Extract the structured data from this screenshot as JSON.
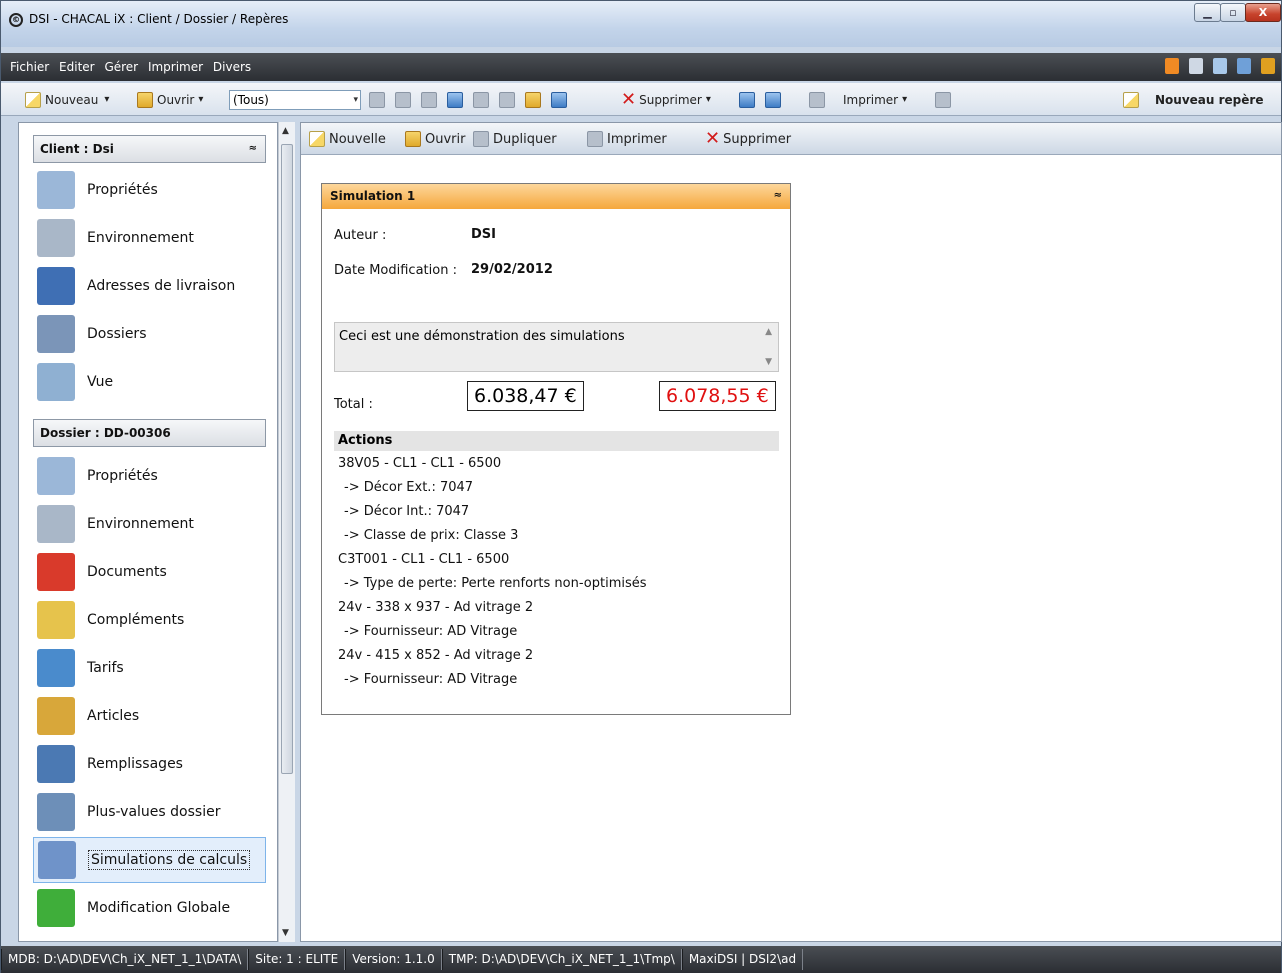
{
  "window": {
    "title": "DSI - CHACAL iX : Client / Dossier / Repères",
    "icon": "©",
    "minimize": "▁",
    "maximize": "▫",
    "close": "X"
  },
  "menu": {
    "items": [
      "Fichier",
      "Editer",
      "Gérer",
      "Imprimer",
      "Divers"
    ]
  },
  "toolbar": {
    "new_label": "Nouveau",
    "open_label": "Ouvrir",
    "filter_value": "(Tous)",
    "delete_label": "Supprimer",
    "print_label": "Imprimer",
    "new_mark_label": "Nouveau repère",
    "dropdown_glyph": "▾"
  },
  "sidebar": {
    "client_header": "Client : Dsi",
    "client_items": [
      {
        "label": "Propriétés",
        "icon": "properties-icon",
        "color": "#9bb7d8"
      },
      {
        "label": "Environnement",
        "icon": "environment-icon",
        "color": "#a9b7c8"
      },
      {
        "label": "Adresses de livraison",
        "icon": "delivery-truck-icon",
        "color": "#3f6fb4"
      },
      {
        "label": "Dossiers",
        "icon": "folders-icon",
        "color": "#7b95b8"
      },
      {
        "label": "Vue",
        "icon": "view-icon",
        "color": "#8fb0d2"
      }
    ],
    "dossier_header": "Dossier : DD-00306",
    "dossier_items": [
      {
        "label": "Propriétés",
        "icon": "properties-icon",
        "color": "#9bb7d8"
      },
      {
        "label": "Environnement",
        "icon": "environment-icon",
        "color": "#a9b7c8"
      },
      {
        "label": "Documents",
        "icon": "pdf-document-icon",
        "color": "#d93a2b"
      },
      {
        "label": "Compléments",
        "icon": "complements-icon",
        "color": "#e6c34c"
      },
      {
        "label": "Tarifs",
        "icon": "tariffs-icon",
        "color": "#4a8bcc"
      },
      {
        "label": "Articles",
        "icon": "articles-icon",
        "color": "#d8a73a"
      },
      {
        "label": "Remplissages",
        "icon": "fillings-icon",
        "color": "#4b79b3"
      },
      {
        "label": "Plus-values dossier",
        "icon": "plus-value-icon",
        "color": "#6d8fb8"
      },
      {
        "label": "Simulations de calculs",
        "icon": "calculator-icon",
        "color": "#6f93c9"
      },
      {
        "label": "Modification Globale",
        "icon": "refresh-icon",
        "color": "#3fae3a"
      }
    ],
    "collapse_glyph": "≈"
  },
  "subtoolbar": {
    "new_label": "Nouvelle",
    "open_label": "Ouvrir",
    "duplicate_label": "Dupliquer",
    "print_label": "Imprimer",
    "delete_label": "Supprimer"
  },
  "simulation": {
    "title": "Simulation 1",
    "author_label": "Auteur :",
    "author_value": "DSI",
    "date_label": "Date Modification :",
    "date_value": "29/02/2012",
    "description": "Ceci est une démonstration des simulations",
    "total_label": "Total :",
    "total_value": "6.038,47 €",
    "total_value_alt": "6.078,55 €",
    "total_alt_color": "#e01010",
    "actions_header": "Actions",
    "actions": [
      {
        "text": "38V05 -  CL1 -  CL1 - 6500",
        "sub": false
      },
      {
        "text": "-> Décor Ext.: 7047",
        "sub": true
      },
      {
        "text": "-> Décor Int.: 7047",
        "sub": true
      },
      {
        "text": "-> Classe de prix: Classe 3",
        "sub": true
      },
      {
        "text": "C3T001 -  CL1 -  CL1 - 6500",
        "sub": false
      },
      {
        "text": "-> Type de perte: Perte renforts non-optimisés",
        "sub": true
      },
      {
        "text": "24v - 338 x 937 - Ad vitrage 2",
        "sub": false
      },
      {
        "text": "-> Fournisseur: AD Vitrage",
        "sub": true
      },
      {
        "text": "24v - 415 x 852 - Ad vitrage 2",
        "sub": false
      },
      {
        "text": "-> Fournisseur: AD Vitrage",
        "sub": true
      }
    ]
  },
  "statusbar": {
    "segments": [
      "MDB: D:\\AD\\DEV\\Ch_iX_NET_1_1\\DATA\\",
      "Site: 1 : ELITE",
      "Version: 1.1.0",
      "TMP: D:\\AD\\DEV\\Ch_iX_NET_1_1\\Tmp\\",
      "MaxiDSI | DSI2\\ad"
    ]
  }
}
